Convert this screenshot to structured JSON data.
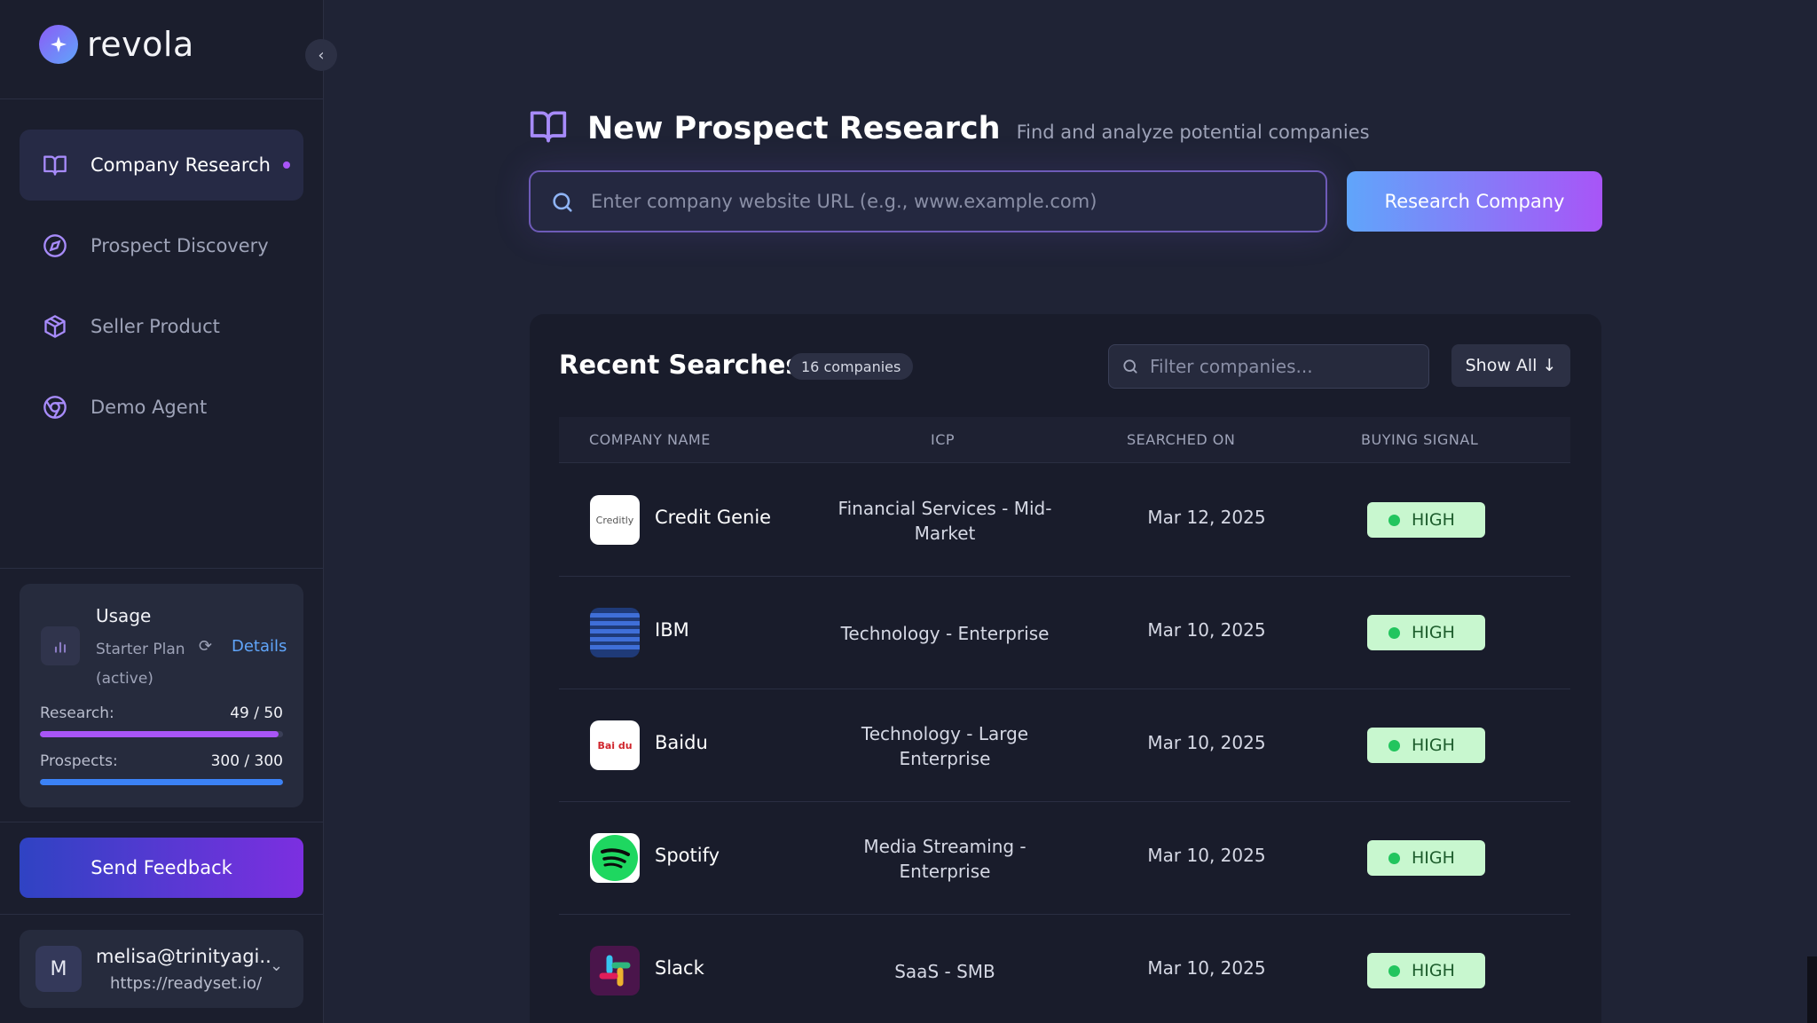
{
  "brand": {
    "name": "revola"
  },
  "sidebar": {
    "items": [
      {
        "label": "Company Research",
        "icon": "book-open-icon",
        "active": true
      },
      {
        "label": "Prospect Discovery",
        "icon": "compass-icon",
        "active": false
      },
      {
        "label": "Seller Product",
        "icon": "package-icon",
        "active": false
      },
      {
        "label": "Demo Agent",
        "icon": "chrome-icon",
        "active": false
      }
    ],
    "usage": {
      "title": "Usage",
      "plan": "Starter Plan (active)",
      "details": "Details",
      "research_label": "Research:",
      "research_value": "49 / 50",
      "research_fraction": 0.98,
      "prospects_label": "Prospects:",
      "prospects_value": "300 / 300",
      "prospects_fraction": 1.0
    },
    "feedback_label": "Send Feedback",
    "user": {
      "initial": "M",
      "email": "melisa@trinityagi...",
      "site": "https://readyset.io/"
    }
  },
  "header": {
    "title": "New Prospect Research",
    "subtitle": "Find and analyze potential companies"
  },
  "search": {
    "placeholder": "Enter company website URL (e.g., www.example.com)",
    "button_label": "Research Company"
  },
  "recent": {
    "title": "Recent Searches",
    "count": "16 companies",
    "filter_placeholder": "Filter companies...",
    "show_all_label": "Show All",
    "columns": [
      "COMPANY NAME",
      "ICP",
      "SEARCHED ON",
      "BUYING SIGNAL"
    ],
    "rows": [
      {
        "company": "Credit Genie",
        "icp": "Financial Services - Mid-Market",
        "date": "Mar 12, 2025",
        "signal": "HIGH",
        "logo_text": "Creditly"
      },
      {
        "company": "IBM",
        "icp": "Technology - Enterprise",
        "date": "Mar 10, 2025",
        "signal": "HIGH",
        "logo_text": ""
      },
      {
        "company": "Baidu",
        "icp": "Technology - Large Enterprise",
        "date": "Mar 10, 2025",
        "signal": "HIGH",
        "logo_text": "Bai du"
      },
      {
        "company": "Spotify",
        "icp": "Media Streaming - Enterprise",
        "date": "Mar 10, 2025",
        "signal": "HIGH",
        "logo_text": ""
      },
      {
        "company": "Slack",
        "icp": "SaaS - SMB",
        "date": "Mar 10, 2025",
        "signal": "HIGH",
        "logo_text": ""
      }
    ]
  },
  "colors": {
    "accent": "#a855f7",
    "research_bar": "#a855f7",
    "prospect_bar": "#3b82f6",
    "signal_high_bg": "#c8f7cf"
  }
}
